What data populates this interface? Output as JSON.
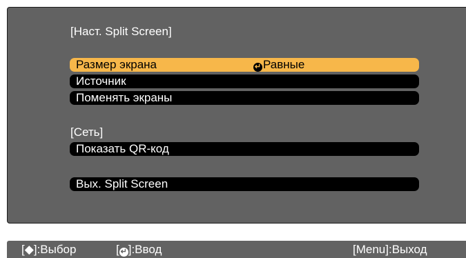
{
  "menu": {
    "title": "[Наст. Split Screen]",
    "items": [
      {
        "label": "Размер экрана",
        "value": "Равные",
        "selected": true
      },
      {
        "label": "Источник"
      },
      {
        "label": "Поменять экраны"
      }
    ],
    "network_section": {
      "title": "[Сеть]",
      "items": [
        {
          "label": "Показать QR-код"
        }
      ]
    },
    "exit_item": {
      "label": "Вых. Split Screen"
    }
  },
  "footer": {
    "select_hint": {
      "bracket_open": "[",
      "arrow_symbol": "◆",
      "bracket_close": "]:Выбор"
    },
    "enter_hint": {
      "bracket_open": "[",
      "bracket_close": "]:Ввод"
    },
    "exit_hint": "[Menu]:Выход"
  },
  "icons": {
    "enter": "enter-icon",
    "up-down": "up-down-arrow-icon"
  },
  "colors": {
    "panel_background": "#626262",
    "item_background": "#000000",
    "selected_highlight": "#f7b74a",
    "text": "#ffffff"
  }
}
